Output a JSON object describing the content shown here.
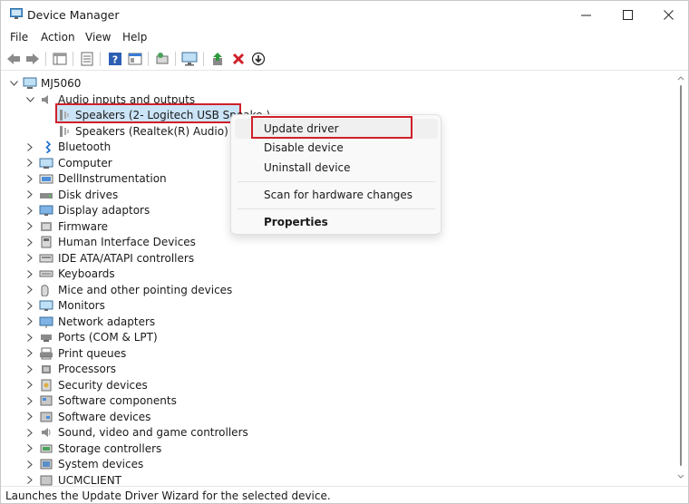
{
  "window": {
    "title": "Device Manager"
  },
  "menu": [
    "File",
    "Action",
    "View",
    "Help"
  ],
  "toolbar": {
    "buttons": [
      "back-icon",
      "forward-icon",
      "show-hide-icon",
      "properties-icon",
      "help-icon",
      "view-icon",
      "scan-icon",
      "monitor-icon",
      "update-driver-icon",
      "uninstall-icon",
      "download-icon"
    ]
  },
  "tree": {
    "root": "MJ5060",
    "audio": {
      "label": "Audio inputs and outputs",
      "children": [
        "Speakers (2- Logitech USB Speake·)",
        "Speakers (Realtek(R) Audio)"
      ]
    },
    "categories": [
      "Bluetooth",
      "Computer",
      "DellInstrumentation",
      "Disk drives",
      "Display adaptors",
      "Firmware",
      "Human Interface Devices",
      "IDE ATA/ATAPI controllers",
      "Keyboards",
      "Mice and other pointing devices",
      "Monitors",
      "Network adapters",
      "Ports (COM & LPT)",
      "Print queues",
      "Processors",
      "Security devices",
      "Software components",
      "Software devices",
      "Sound, video and game controllers",
      "Storage controllers",
      "System devices",
      "UCMCLIENT"
    ]
  },
  "context_menu": {
    "update": "Update driver",
    "disable": "Disable device",
    "uninstall": "Uninstall device",
    "scan": "Scan for hardware changes",
    "properties": "Properties"
  },
  "status": "Launches the Update Driver Wizard for the selected device.",
  "colors": {
    "highlight_outline": "#d0202a",
    "selection": "#cce4f7"
  }
}
